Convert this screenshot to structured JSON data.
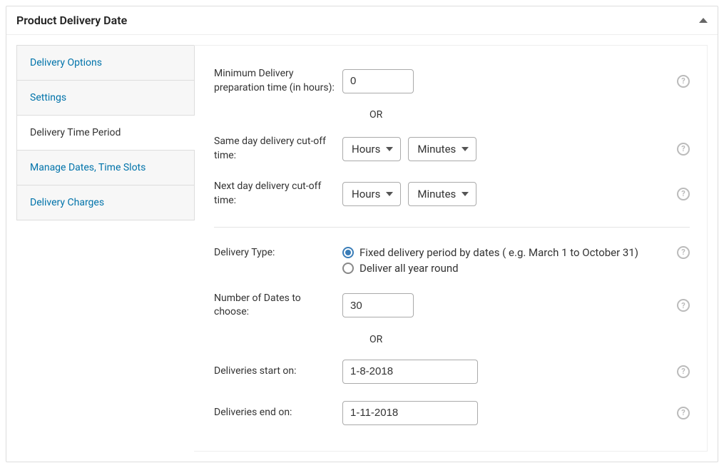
{
  "panel": {
    "title": "Product Delivery Date"
  },
  "sidebar": {
    "items": [
      {
        "label": "Delivery Options",
        "active": false
      },
      {
        "label": "Settings",
        "active": false
      },
      {
        "label": "Delivery Time Period",
        "active": true
      },
      {
        "label": "Manage Dates, Time Slots",
        "active": false
      },
      {
        "label": "Delivery Charges",
        "active": false
      }
    ]
  },
  "form": {
    "min_prep_label": "Minimum Delivery preparation time (in hours):",
    "min_prep_value": "0",
    "or_text": "OR",
    "same_day_label": "Same day delivery cut-off time:",
    "next_day_label": "Next day delivery cut-off time:",
    "hours_option": "Hours",
    "minutes_option": "Minutes",
    "delivery_type_label": "Delivery Type:",
    "delivery_type_options": {
      "fixed": "Fixed delivery period by dates ( e.g. March 1 to October 31)",
      "all_year": "Deliver all year round"
    },
    "delivery_type_selected": "fixed",
    "num_dates_label": "Number of Dates to choose:",
    "num_dates_value": "30",
    "start_label": "Deliveries start on:",
    "start_value": "1-8-2018",
    "end_label": "Deliveries end on:",
    "end_value": "1-11-2018"
  }
}
